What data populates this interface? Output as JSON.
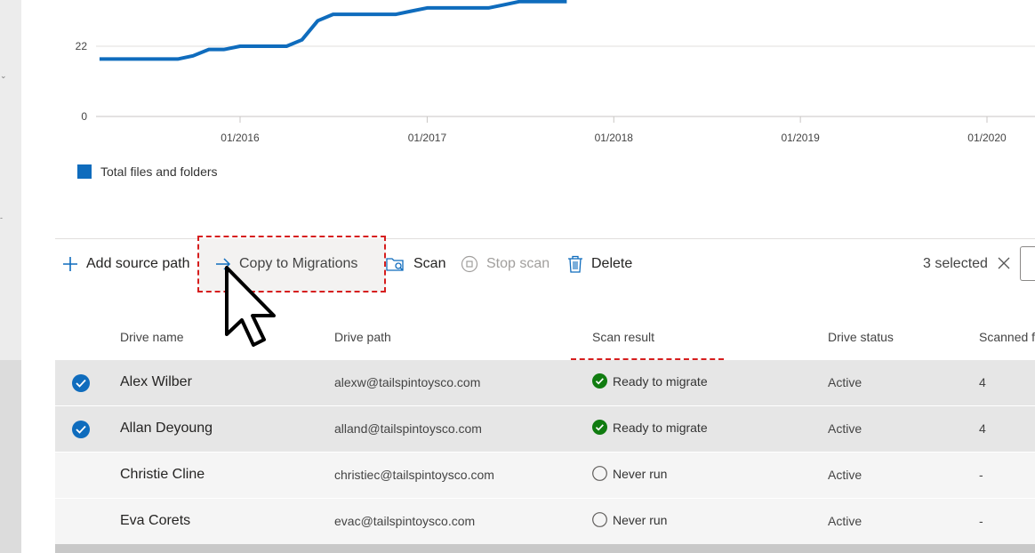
{
  "chart_data": {
    "type": "line",
    "title": "",
    "xlabel": "",
    "ylabel": "",
    "y_ticks": [
      0,
      22
    ],
    "x_ticks": [
      "01/2016",
      "01/2017",
      "01/2018",
      "01/2019",
      "01/2020"
    ],
    "xlim": [
      "2015-04-01",
      "2020-04-01"
    ],
    "ylim": [
      0,
      44
    ],
    "legend_position": "bottom-left",
    "series": [
      {
        "name": "Total files and folders",
        "color": "#0f6cbd",
        "points": [
          [
            "2015-04-01",
            18
          ],
          [
            "2015-06-01",
            18
          ],
          [
            "2015-08-01",
            18
          ],
          [
            "2015-09-01",
            18
          ],
          [
            "2015-10-01",
            19
          ],
          [
            "2015-11-01",
            21
          ],
          [
            "2015-12-01",
            21
          ],
          [
            "2016-01-01",
            22
          ],
          [
            "2016-02-01",
            22
          ],
          [
            "2016-03-01",
            22
          ],
          [
            "2016-04-01",
            22
          ],
          [
            "2016-05-01",
            24
          ],
          [
            "2016-06-01",
            30
          ],
          [
            "2016-07-01",
            32
          ],
          [
            "2016-08-01",
            32
          ],
          [
            "2016-09-01",
            32
          ],
          [
            "2016-10-01",
            32
          ],
          [
            "2016-11-01",
            32
          ],
          [
            "2016-12-01",
            33
          ],
          [
            "2017-01-01",
            34
          ],
          [
            "2017-02-01",
            34
          ],
          [
            "2017-03-01",
            34
          ],
          [
            "2017-04-01",
            34
          ],
          [
            "2017-05-01",
            34
          ],
          [
            "2017-06-01",
            35
          ],
          [
            "2017-07-01",
            36
          ],
          [
            "2017-08-01",
            36
          ],
          [
            "2017-09-01",
            36
          ],
          [
            "2017-10-01",
            36
          ]
        ]
      }
    ]
  },
  "toolbar": {
    "add_source_path": "Add source path",
    "copy_to_migrations": "Copy to Migrations",
    "scan": "Scan",
    "stop_scan": "Stop scan",
    "delete": "Delete",
    "selected_count": "3 selected"
  },
  "table": {
    "headers": {
      "drive_name": "Drive name",
      "drive_path": "Drive path",
      "scan_result": "Scan result",
      "drive_status": "Drive status",
      "scanned": "Scanned f"
    },
    "rows": [
      {
        "name": "Alex Wilber",
        "path": "alexw@tailspintoysco.com",
        "scan_result": "Ready to migrate",
        "status": "Active",
        "count": "4",
        "selected": true
      },
      {
        "name": "Allan Deyoung",
        "path": "alland@tailspintoysco.com",
        "scan_result": "Ready to migrate",
        "status": "Active",
        "count": "4",
        "selected": true
      },
      {
        "name": "Christie Cline",
        "path": "christiec@tailspintoysco.com",
        "scan_result": "Never run",
        "status": "Active",
        "count": "-",
        "selected": false
      },
      {
        "name": "Eva Corets",
        "path": "evac@tailspintoysco.com",
        "scan_result": "Never run",
        "status": "Active",
        "count": "-",
        "selected": false
      }
    ]
  },
  "colors": {
    "accent": "#0f6cbd",
    "success": "#107c10",
    "highlight": "#d61e1e"
  }
}
